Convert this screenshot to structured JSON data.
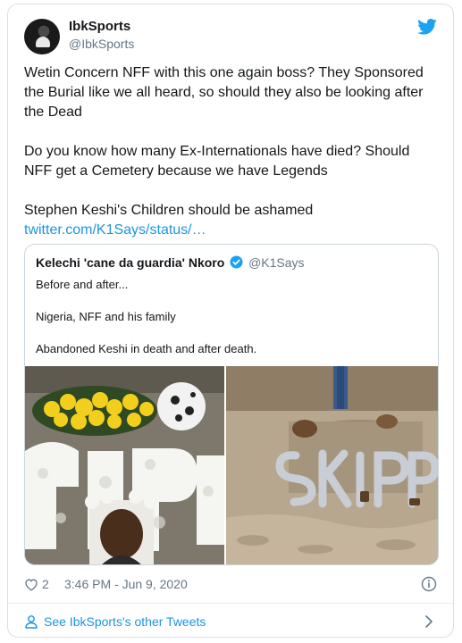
{
  "tweet": {
    "display_name": "IbkSports",
    "handle": "@IbkSports",
    "paragraphs": [
      "Wetin Concern NFF with this one again boss? They Sponsored the Burial like we all heard, so should they also be looking after the Dead",
      "Do you know how many Ex-Internationals have died? Should NFF get a Cemetery because we have Legends",
      "Stephen Keshi's Children should be ashamed"
    ],
    "link": "twitter.com/K1Says/status/…",
    "likes": "2",
    "timestamp": "3:46 PM - Jun 9, 2020"
  },
  "quote": {
    "name": "Kelechi 'cane da guardia' Nkoro",
    "handle": "@K1Says",
    "lines": [
      "Before and after...",
      "Nigeria, NFF and his family",
      "Abandoned Keshi in death and after death."
    ]
  },
  "footer": {
    "see_more": "See IbkSports's other Tweets"
  },
  "colors": {
    "link": "#1b95e0",
    "secondary": "#657786",
    "twitter_blue": "#1da1f2"
  },
  "icons": [
    "twitter-bird-icon",
    "verified-badge-icon",
    "heart-icon",
    "info-icon",
    "person-icon",
    "chevron-right-icon"
  ]
}
